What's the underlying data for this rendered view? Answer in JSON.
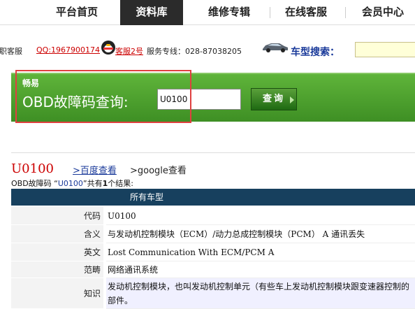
{
  "nav": {
    "items": [
      "平台首页",
      "资料库",
      "维修专辑",
      "在线客服",
      "会员中心"
    ],
    "active": 1
  },
  "service": {
    "prefix": "专职客服",
    "qq": "QQ:1967900174",
    "kefu2": "客服2号",
    "hotline": "服务专线：028-87038205",
    "car_search_label": "车型搜索：",
    "car_search_value": ""
  },
  "obd": {
    "brand": "畅易",
    "title": "OBD故障码查询:",
    "input_value": "U0100",
    "button_label": "查询"
  },
  "result": {
    "code": "U0100",
    "baidu": ">百度查看",
    "google": ">google查看",
    "summary_prefix": "OBD故障码 “",
    "summary_code": "U0100",
    "summary_mid": "”共有",
    "summary_count": "1",
    "summary_suffix": "个结果:"
  },
  "table": {
    "header": "所有车型",
    "rows": [
      {
        "key": "代码",
        "value": "U0100"
      },
      {
        "key": "含义",
        "value": "与发动机控制模块（ECM）/动力总成控制模块（PCM） A 通讯丢失"
      },
      {
        "key": "英文",
        "value": "Lost Communication With ECM/PCM A"
      },
      {
        "key": "范畴",
        "value": "网络通讯系统"
      },
      {
        "key": "知识",
        "value": "发动机控制模块，也叫发动机控制单元（有些车上发动机控制模块跟变速器控制的部件。"
      }
    ]
  },
  "colors": {
    "panel_green": "#4ea52e",
    "table_header": "#17405e",
    "accent_red": "#cc0000",
    "link_blue": "#1a3a9a"
  },
  "icons": [
    "qq-penguin-icon",
    "car-icon",
    "search-arrow-icon"
  ]
}
